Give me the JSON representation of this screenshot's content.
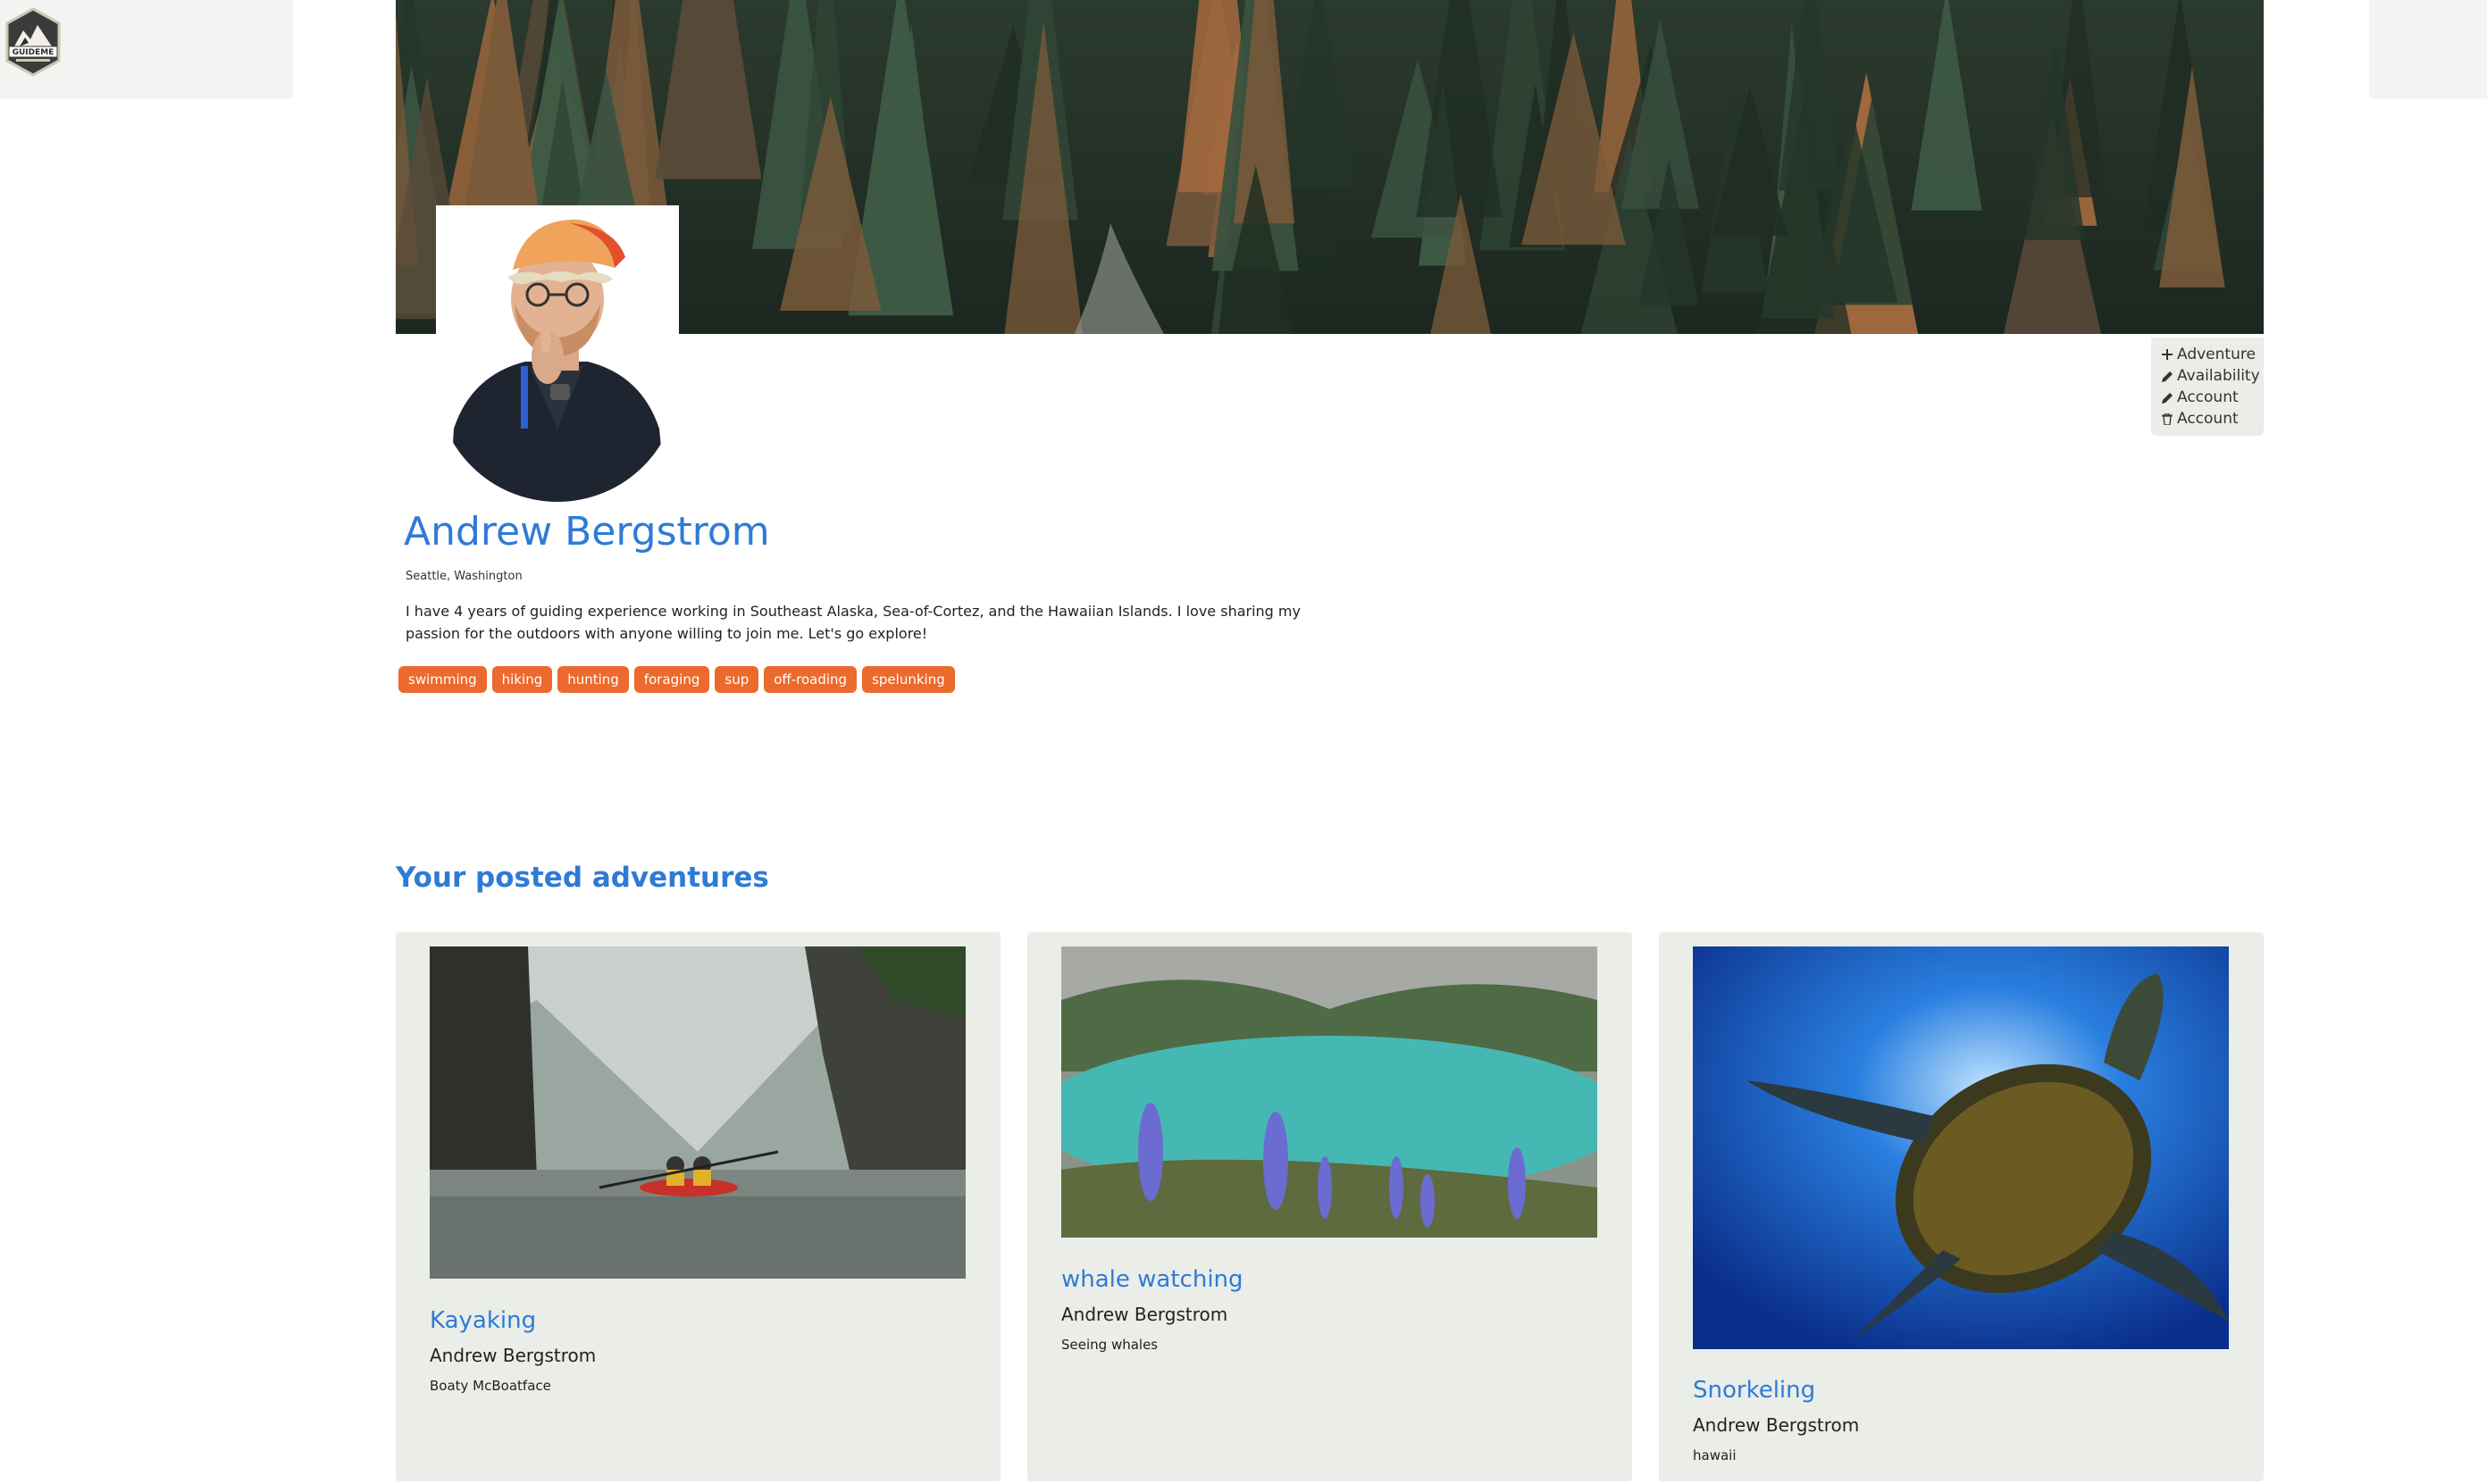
{
  "logo": {
    "text": "GUIDEME"
  },
  "actions": [
    {
      "icon": "plus-icon",
      "label": "Adventure"
    },
    {
      "icon": "pencil-icon",
      "label": "Availability"
    },
    {
      "icon": "pencil-icon",
      "label": "Account"
    },
    {
      "icon": "trash-icon",
      "label": "Account"
    }
  ],
  "profile": {
    "name": "Andrew Bergstrom",
    "location": "Seattle, Washington",
    "bio": "I have 4 years of guiding experience working in Southeast Alaska, Sea-of-Cortez, and the Hawaiian Islands. I love sharing my passion for the outdoors with anyone willing to join me. Let's go explore!",
    "tags": [
      "swimming",
      "hiking",
      "hunting",
      "foraging",
      "sup",
      "off-roading",
      "spelunking"
    ]
  },
  "colors": {
    "accent": "#2e7bd6",
    "tag": "#ec6a2e",
    "card_bg": "#eaede8"
  },
  "section": {
    "title": "Your posted adventures"
  },
  "adventures": [
    {
      "title": "Kayaking",
      "guide": "Andrew Bergstrom",
      "description": "Boaty McBoatface"
    },
    {
      "title": "whale watching",
      "guide": "Andrew Bergstrom",
      "description": "Seeing whales"
    },
    {
      "title": "Snorkeling",
      "guide": "Andrew Bergstrom",
      "description": "hawaii"
    }
  ]
}
